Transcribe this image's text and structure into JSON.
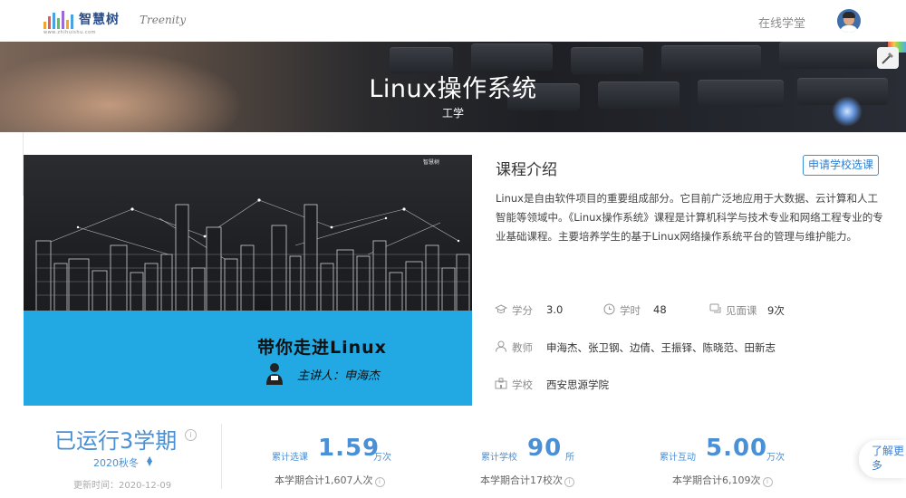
{
  "header": {
    "logo_text": "智慧树",
    "logo_sub": "www.zhihuishu.com",
    "logo_script": "Treenity",
    "nav_link": "在线学堂",
    "logo_colors": [
      "#f0a531",
      "#e85b5b",
      "#4aa3df",
      "#5fbf6a",
      "#9b6ad3",
      "#f0a531",
      "#4aa3df"
    ]
  },
  "banner": {
    "title": "Linux操作系统",
    "subtitle": "工学"
  },
  "video": {
    "logo": "智慧树",
    "title": "带你走进Linux",
    "lead": "主讲人：申海杰"
  },
  "intro": {
    "title": "课程介绍",
    "apply_button": "申请学校选课",
    "text": "Linux是自由软件项目的重要组成部分。它目前广泛地应用于大数据、云计算和人工智能等领域中。《Linux操作系统》课程是计算机科学与技术专业和网络工程专业的专业基础课程。主要培养学生的基于Linux网络操作系统平台的管理与维护能力。"
  },
  "meta": {
    "credit_label": "学分",
    "credit_value": "3.0",
    "hours_label": "学时",
    "hours_value": "48",
    "meet_label": "见面课",
    "meet_value": "9次",
    "teacher_label": "教师",
    "teacher_value": "申海杰、张卫钢、边倩、王振铎、陈晓范、田新志",
    "school_label": "学校",
    "school_value": "西安思源学院"
  },
  "stats": {
    "running": "已运行3学期",
    "semester": "2020秋冬",
    "updated": "更新时间：2020-12-09",
    "enroll_label": "累计选课",
    "enroll_value": "1.59",
    "enroll_unit": "万次",
    "enroll_sub": "本学期合计1,607人次",
    "schools_label": "累计学校",
    "schools_value": "90",
    "schools_unit": "所",
    "schools_sub": "本学期合计17校次",
    "interact_label": "累计互动",
    "interact_value": "5.00",
    "interact_unit": "万次",
    "interact_sub": "本学期合计6,109次"
  },
  "side": {
    "learn_more": "了解更多"
  },
  "colors": {
    "accent": "#4a90d6",
    "button_border": "#3b8ed8",
    "video_blue": "#22a9e4"
  }
}
